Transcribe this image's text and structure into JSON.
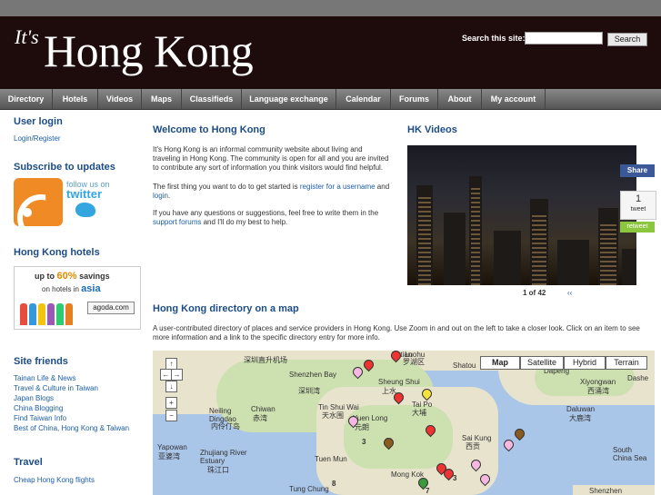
{
  "header": {
    "logo_prefix": "It's",
    "logo_title": "Hong Kong",
    "search_label": "Search this site:",
    "search_value": "",
    "search_button": "Search"
  },
  "nav": [
    "Directory",
    "Hotels",
    "Videos",
    "Maps",
    "Classifieds",
    "Language exchange",
    "Calendar",
    "Forums",
    "About",
    "My account"
  ],
  "sidebar": {
    "login_title": "User login",
    "login_link": "Login/Register",
    "subscribe_title": "Subscribe to updates",
    "twitter_small": "follow us on",
    "twitter_word": "twitter",
    "hotels_title": "Hong Kong hotels",
    "agoda_line1_pre": "up to",
    "agoda_line1_pct": "60%",
    "agoda_line1_post": "savings",
    "agoda_line2_pre": "on hotels in",
    "agoda_line2_asia": "asia",
    "agoda_logo": "agoda.com",
    "friends_title": "Site friends",
    "friends": [
      "Tainan Life & News",
      "Travel & Culture in Taiwan",
      "Japan Blogs",
      "China Blogging",
      "Find Taiwan Info",
      "Best of China, Hong Kong & Taiwan"
    ],
    "travel_title": "Travel",
    "travel_link": "Cheap Hong Kong flights"
  },
  "main": {
    "welcome_title": "Welcome to Hong Kong",
    "p1": "It's Hong Kong is an informal community website about living and traveling in Hong Kong. The community is open for all and you are invited to contribute any sort of information you think visitors would find helpful.",
    "p2_pre": "The first thing you want to do to get started is ",
    "p2_link1": "register for a username",
    "p2_mid": " and ",
    "p2_link2": "login",
    "p2_post": ".",
    "p3_pre": "If you have any questions or suggestions, feel free to write them in the ",
    "p3_link": "support forums",
    "p3_post": " and I'll do my best to help.",
    "map_title": "Hong Kong directory on a map",
    "map_desc": "A user-contributed directory of places and service providers in Hong Kong. Use Zoom in and out on the left to take a closer look. Click on an item to see more information and a link to the specific directory entry for more info."
  },
  "videos": {
    "title": "HK Videos",
    "counter": "1 of 42",
    "arrows": "‹‹",
    "share": "Share",
    "tweet_count": "1",
    "tweet_label": "tweet",
    "retweet": "retweet"
  },
  "map": {
    "types": [
      "Map",
      "Satellite",
      "Hybrid",
      "Terrain"
    ],
    "labels": [
      "Futian",
      "Luohu",
      "深圳直升机场",
      "罗湖区",
      "Shenzhen Bay",
      "深圳湾",
      "Sheung Shui",
      "上水",
      "Tai Po",
      "大埔",
      "Neiling Dingdao",
      "内伶仃岛",
      "Chiwan",
      "赤湾",
      "Tin Shui Wai",
      "天水围",
      "Yuen Long",
      "元朗",
      "Sai Kung",
      "西贡",
      "Yapowan",
      "亚婆湾",
      "Zhujiang River Estuary",
      "珠江口",
      "Tuen Mun",
      "Mong Kok",
      "Tung Chung",
      "South China Sea",
      "Xiyongwan",
      "西涌湾",
      "Dapeng",
      "Dashe",
      "Daluwan",
      "大鹿湾",
      "Shenzhen",
      "Shatou",
      "3",
      "8",
      "3",
      "7"
    ]
  }
}
